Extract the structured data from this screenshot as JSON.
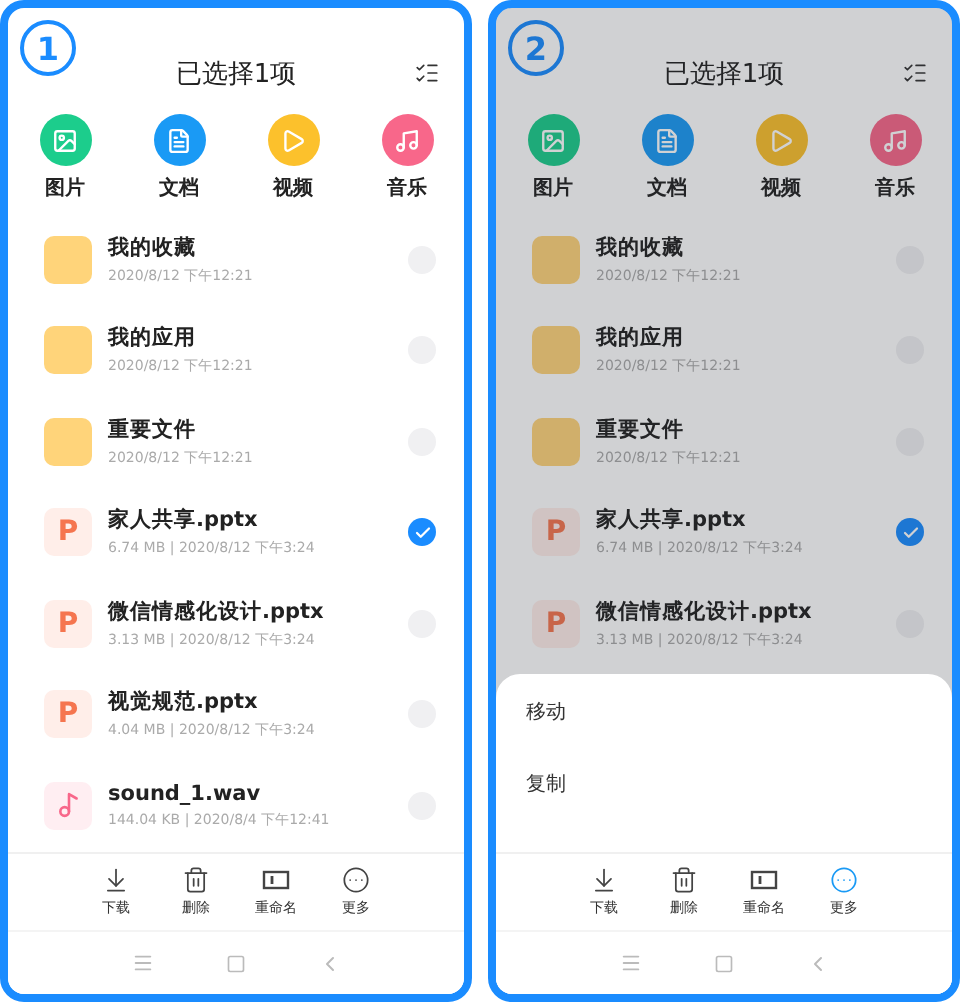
{
  "phones": [
    {
      "badge": "1",
      "title": "已选择1项",
      "categories": [
        {
          "label": "图片",
          "kind": "image"
        },
        {
          "label": "文档",
          "kind": "doc"
        },
        {
          "label": "视频",
          "kind": "video"
        },
        {
          "label": "音乐",
          "kind": "music"
        }
      ],
      "files": [
        {
          "name": "我的收藏",
          "meta": "2020/8/12 下午12:21",
          "kind": "folder",
          "checked": false
        },
        {
          "name": "我的应用",
          "meta": "2020/8/12 下午12:21",
          "kind": "folder",
          "checked": false
        },
        {
          "name": "重要文件",
          "meta": "2020/8/12 下午12:21",
          "kind": "folder",
          "checked": false
        },
        {
          "name": "家人共享.pptx",
          "meta": "6.74 MB | 2020/8/12 下午3:24",
          "kind": "ppt",
          "letter": "P",
          "checked": true
        },
        {
          "name": "微信情感化设计.pptx",
          "meta": "3.13 MB | 2020/8/12 下午3:24",
          "kind": "ppt",
          "letter": "P",
          "checked": false
        },
        {
          "name": "视觉规范.pptx",
          "meta": "4.04 MB | 2020/8/12 下午3:24",
          "kind": "ppt",
          "letter": "P",
          "checked": false
        },
        {
          "name": "sound_1.wav",
          "meta": "144.04 KB | 2020/8/4 下午12:41",
          "kind": "audio",
          "checked": false
        }
      ],
      "toolbar": [
        {
          "label": "下载",
          "kind": "download",
          "active": false
        },
        {
          "label": "删除",
          "kind": "delete",
          "active": false
        },
        {
          "label": "重命名",
          "kind": "rename",
          "active": false
        },
        {
          "label": "更多",
          "kind": "more",
          "active": false
        }
      ]
    },
    {
      "badge": "2",
      "title": "已选择1项",
      "categories": [
        {
          "label": "图片",
          "kind": "image"
        },
        {
          "label": "文档",
          "kind": "doc"
        },
        {
          "label": "视频",
          "kind": "video"
        },
        {
          "label": "音乐",
          "kind": "music"
        }
      ],
      "files": [
        {
          "name": "我的收藏",
          "meta": "2020/8/12 下午12:21",
          "kind": "folder",
          "checked": false
        },
        {
          "name": "我的应用",
          "meta": "2020/8/12 下午12:21",
          "kind": "folder",
          "checked": false
        },
        {
          "name": "重要文件",
          "meta": "2020/8/12 下午12:21",
          "kind": "folder",
          "checked": false
        },
        {
          "name": "家人共享.pptx",
          "meta": "6.74 MB | 2020/8/12 下午3:24",
          "kind": "ppt",
          "letter": "P",
          "checked": true
        },
        {
          "name": "微信情感化设计.pptx",
          "meta": "3.13 MB | 2020/8/12 下午3:24",
          "kind": "ppt",
          "letter": "P",
          "checked": false
        }
      ],
      "sheet": {
        "items": [
          "移动",
          "复制"
        ]
      },
      "toolbar": [
        {
          "label": "下载",
          "kind": "download",
          "active": false
        },
        {
          "label": "删除",
          "kind": "delete",
          "active": false
        },
        {
          "label": "重命名",
          "kind": "rename",
          "active": false
        },
        {
          "label": "更多",
          "kind": "more",
          "active": true
        }
      ]
    }
  ]
}
